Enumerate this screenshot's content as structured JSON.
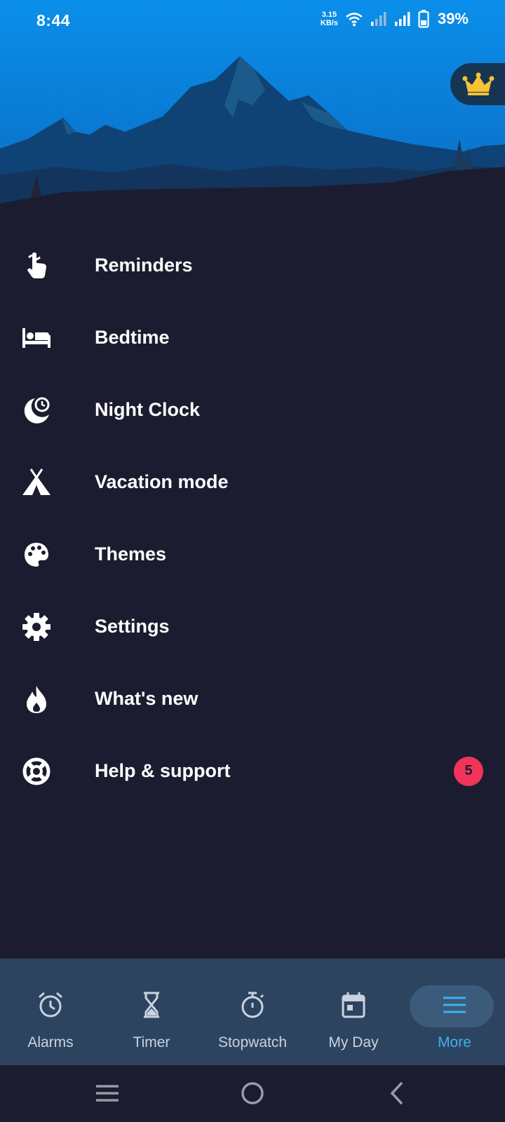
{
  "status_bar": {
    "time": "8:44",
    "net_speed_value": "3.15",
    "net_speed_unit": "KB/s",
    "battery_percent": "39%"
  },
  "menu": {
    "items": [
      {
        "label": "Reminders",
        "icon": "hand-string-icon"
      },
      {
        "label": "Bedtime",
        "icon": "bed-icon"
      },
      {
        "label": "Night Clock",
        "icon": "moon-clock-icon"
      },
      {
        "label": "Vacation mode",
        "icon": "tent-icon"
      },
      {
        "label": "Themes",
        "icon": "palette-icon"
      },
      {
        "label": "Settings",
        "icon": "gear-icon"
      },
      {
        "label": "What's new",
        "icon": "flame-icon"
      },
      {
        "label": "Help & support",
        "icon": "lifebuoy-icon",
        "badge": "5"
      }
    ]
  },
  "bottom_nav": {
    "tabs": [
      {
        "label": "Alarms",
        "icon": "alarm-clock-icon"
      },
      {
        "label": "Timer",
        "icon": "hourglass-icon"
      },
      {
        "label": "Stopwatch",
        "icon": "stopwatch-icon"
      },
      {
        "label": "My Day",
        "icon": "calendar-icon"
      },
      {
        "label": "More",
        "icon": "hamburger-icon"
      }
    ],
    "active_tab": "More"
  },
  "colors": {
    "background": "#1c1c30",
    "sky_top": "#0a8fea",
    "bottom_nav_bg": "#2d4461",
    "active_accent": "#3fb0f0",
    "badge_red": "#f2335a",
    "crown_gold": "#f7c234"
  }
}
